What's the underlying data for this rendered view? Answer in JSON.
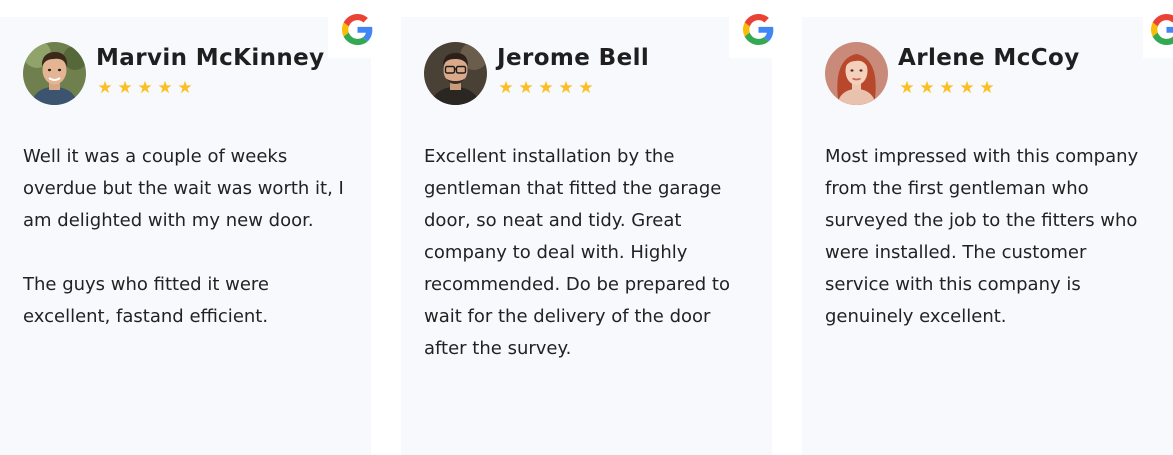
{
  "colors": {
    "card_background": "#f8f9fd",
    "star": "#fbbf24",
    "name_text": "#1f1f1f",
    "body_text": "#222222"
  },
  "badge_icon": "google-icon",
  "reviews": [
    {
      "name": "Marvin McKinney",
      "rating": 5,
      "stars": [
        "★",
        "★",
        "★",
        "★",
        "★"
      ],
      "paragraphs": [
        "Well it was a couple of weeks overdue but the wait was worth it, I am delighted with my new door.",
        "The guys who fitted it were excellent, fastand efficient."
      ]
    },
    {
      "name": "Jerome Bell",
      "rating": 5,
      "stars": [
        "★",
        "★",
        "★",
        "★",
        "★"
      ],
      "paragraphs": [
        "Excellent installation by the gentleman that fitted the garage door, so neat and tidy. Great company to deal with. Highly recommended. Do be prepared to wait for the delivery of the door after the survey."
      ]
    },
    {
      "name": "Arlene McCoy",
      "rating": 5,
      "stars": [
        "★",
        "★",
        "★",
        "★",
        "★"
      ],
      "paragraphs": [
        "Most impressed with this company from the first gentleman who surveyed the job to the fitters who were installed. The customer service with this company is genuinely excellent."
      ]
    }
  ]
}
